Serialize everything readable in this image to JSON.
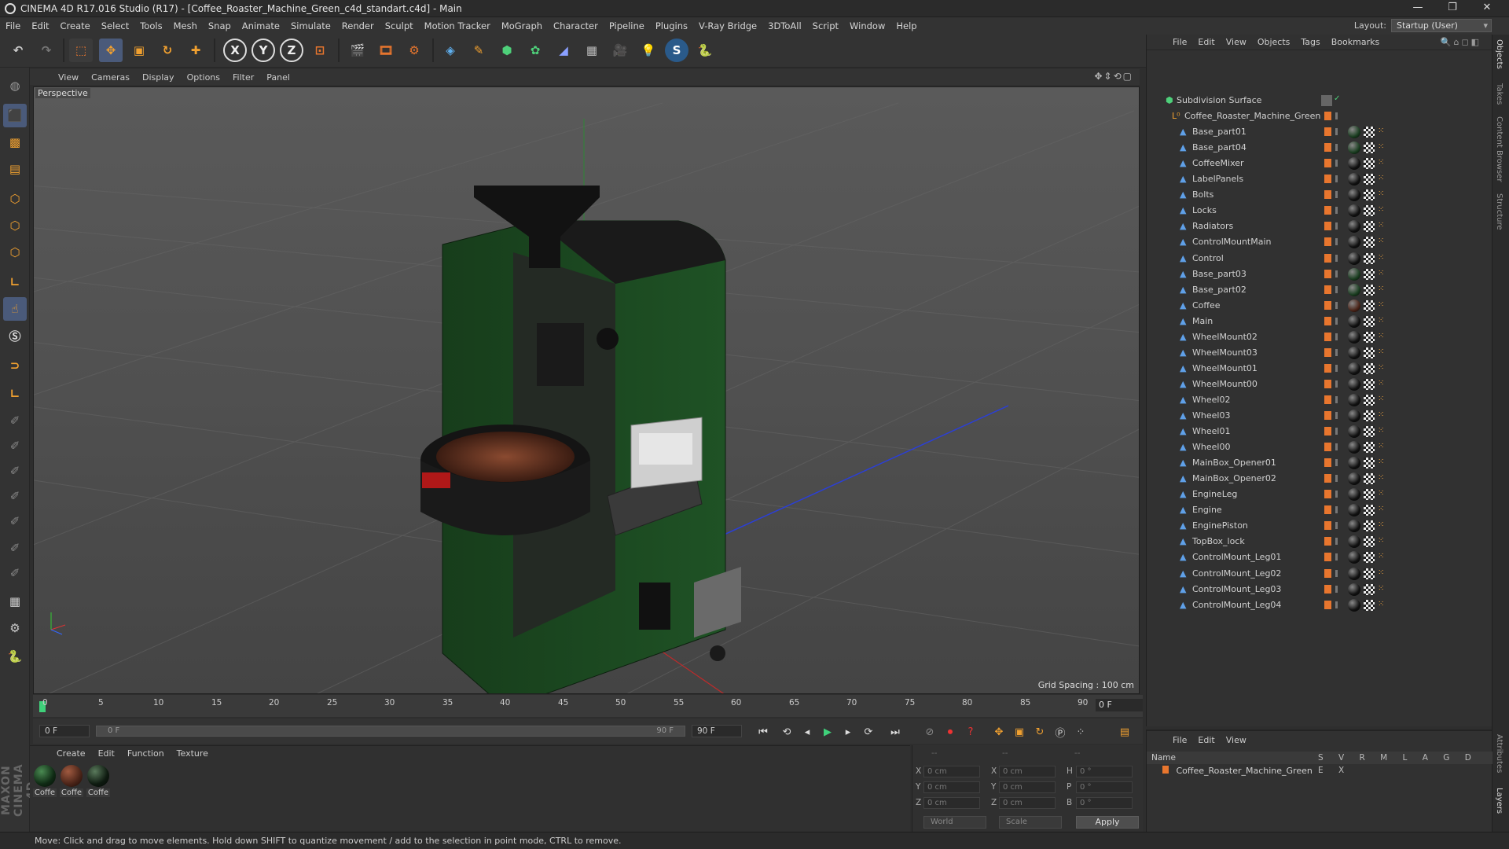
{
  "window": {
    "title": "CINEMA 4D R17.016 Studio (R17) - [Coffee_Roaster_Machine_Green_c4d_standart.c4d] - Main"
  },
  "menu": [
    "File",
    "Edit",
    "Create",
    "Select",
    "Tools",
    "Mesh",
    "Snap",
    "Animate",
    "Simulate",
    "Render",
    "Sculpt",
    "Motion Tracker",
    "MoGraph",
    "Character",
    "Pipeline",
    "Plugins",
    "V-Ray Bridge",
    "3DToAll",
    "Script",
    "Window",
    "Help"
  ],
  "layout": {
    "label": "Layout:",
    "value": "Startup (User)"
  },
  "viewport": {
    "menu": [
      "View",
      "Cameras",
      "Display",
      "Options",
      "Filter",
      "Panel"
    ],
    "camera_label": "Perspective",
    "grid_spacing": "Grid Spacing : 100 cm"
  },
  "timeline": {
    "ticks": [
      "0",
      "5",
      "10",
      "15",
      "20",
      "25",
      "30",
      "35",
      "40",
      "45",
      "50",
      "55",
      "60",
      "65",
      "70",
      "75",
      "80",
      "85",
      "90"
    ],
    "current_frame": "0 F",
    "start_field": "0 F",
    "range_start": "0 F",
    "range_end": "90 F",
    "end_field": "90 F"
  },
  "materials": {
    "menu": [
      "Create",
      "Edit",
      "Function",
      "Texture"
    ],
    "items": [
      {
        "label": "Coffe",
        "color": "#0f2a14"
      },
      {
        "label": "Coffe",
        "color": "#4a2418"
      },
      {
        "label": "Coffe",
        "color": "#0e1a10"
      }
    ]
  },
  "coords": {
    "header": [
      "--",
      "--",
      "--"
    ],
    "rows": [
      {
        "a": "X",
        "av": "0 cm",
        "b": "X",
        "bv": "0 cm",
        "c": "H",
        "cv": "0 °"
      },
      {
        "a": "Y",
        "av": "0 cm",
        "b": "Y",
        "bv": "0 cm",
        "c": "P",
        "cv": "0 °"
      },
      {
        "a": "Z",
        "av": "0 cm",
        "b": "Z",
        "bv": "0 cm",
        "c": "B",
        "cv": "0 °"
      }
    ],
    "mode": "World",
    "type": "Scale",
    "apply": "Apply"
  },
  "objects": {
    "menu": [
      "File",
      "Edit",
      "View",
      "Objects",
      "Tags",
      "Bookmarks"
    ],
    "root": "Subdivision Surface",
    "group": "Coffee_Roaster_Machine_Green",
    "items": [
      {
        "name": "Base_part01",
        "mat": "#1a3d20"
      },
      {
        "name": "Base_part04",
        "mat": "#1a3d20"
      },
      {
        "name": "CoffeeMixer",
        "mat": "#111"
      },
      {
        "name": "LabelPanels",
        "mat": "#111"
      },
      {
        "name": "Bolts",
        "mat": "#111"
      },
      {
        "name": "Locks",
        "mat": "#111"
      },
      {
        "name": "Radiators",
        "mat": "#111"
      },
      {
        "name": "ControlMountMain",
        "mat": "#111"
      },
      {
        "name": "Control",
        "mat": "#111"
      },
      {
        "name": "Base_part03",
        "mat": "#1a3d20"
      },
      {
        "name": "Base_part02",
        "mat": "#1a3d20"
      },
      {
        "name": "Coffee",
        "mat": "#4a2418"
      },
      {
        "name": "Main",
        "mat": "#111"
      },
      {
        "name": "WheelMount02",
        "mat": "#111"
      },
      {
        "name": "WheelMount03",
        "mat": "#111"
      },
      {
        "name": "WheelMount01",
        "mat": "#111"
      },
      {
        "name": "WheelMount00",
        "mat": "#111"
      },
      {
        "name": "Wheel02",
        "mat": "#111"
      },
      {
        "name": "Wheel03",
        "mat": "#111"
      },
      {
        "name": "Wheel01",
        "mat": "#111"
      },
      {
        "name": "Wheel00",
        "mat": "#111"
      },
      {
        "name": "MainBox_Opener01",
        "mat": "#111"
      },
      {
        "name": "MainBox_Opener02",
        "mat": "#111"
      },
      {
        "name": "EngineLeg",
        "mat": "#111"
      },
      {
        "name": "Engine",
        "mat": "#111"
      },
      {
        "name": "EnginePiston",
        "mat": "#111"
      },
      {
        "name": "TopBox_lock",
        "mat": "#111"
      },
      {
        "name": "ControlMount_Leg01",
        "mat": "#111"
      },
      {
        "name": "ControlMount_Leg02",
        "mat": "#111"
      },
      {
        "name": "ControlMount_Leg03",
        "mat": "#111"
      },
      {
        "name": "ControlMount_Leg04",
        "mat": "#111"
      }
    ]
  },
  "layers": {
    "menu": [
      "File",
      "Edit",
      "View"
    ],
    "header_name": "Name",
    "header_cols": "S V R M L A G D E X",
    "row": "Coffee_Roaster_Machine_Green"
  },
  "right_tabs": [
    "Objects",
    "Takes",
    "Content Browser",
    "Structure",
    "Attributes",
    "Layers"
  ],
  "status": "Move: Click and drag to move elements. Hold down SHIFT to quantize movement / add to the selection in point mode, CTRL to remove.",
  "colors": {
    "accent": "#e8762e",
    "object_icon": "#5fa0e8",
    "machine_green": "#1f4d24"
  }
}
